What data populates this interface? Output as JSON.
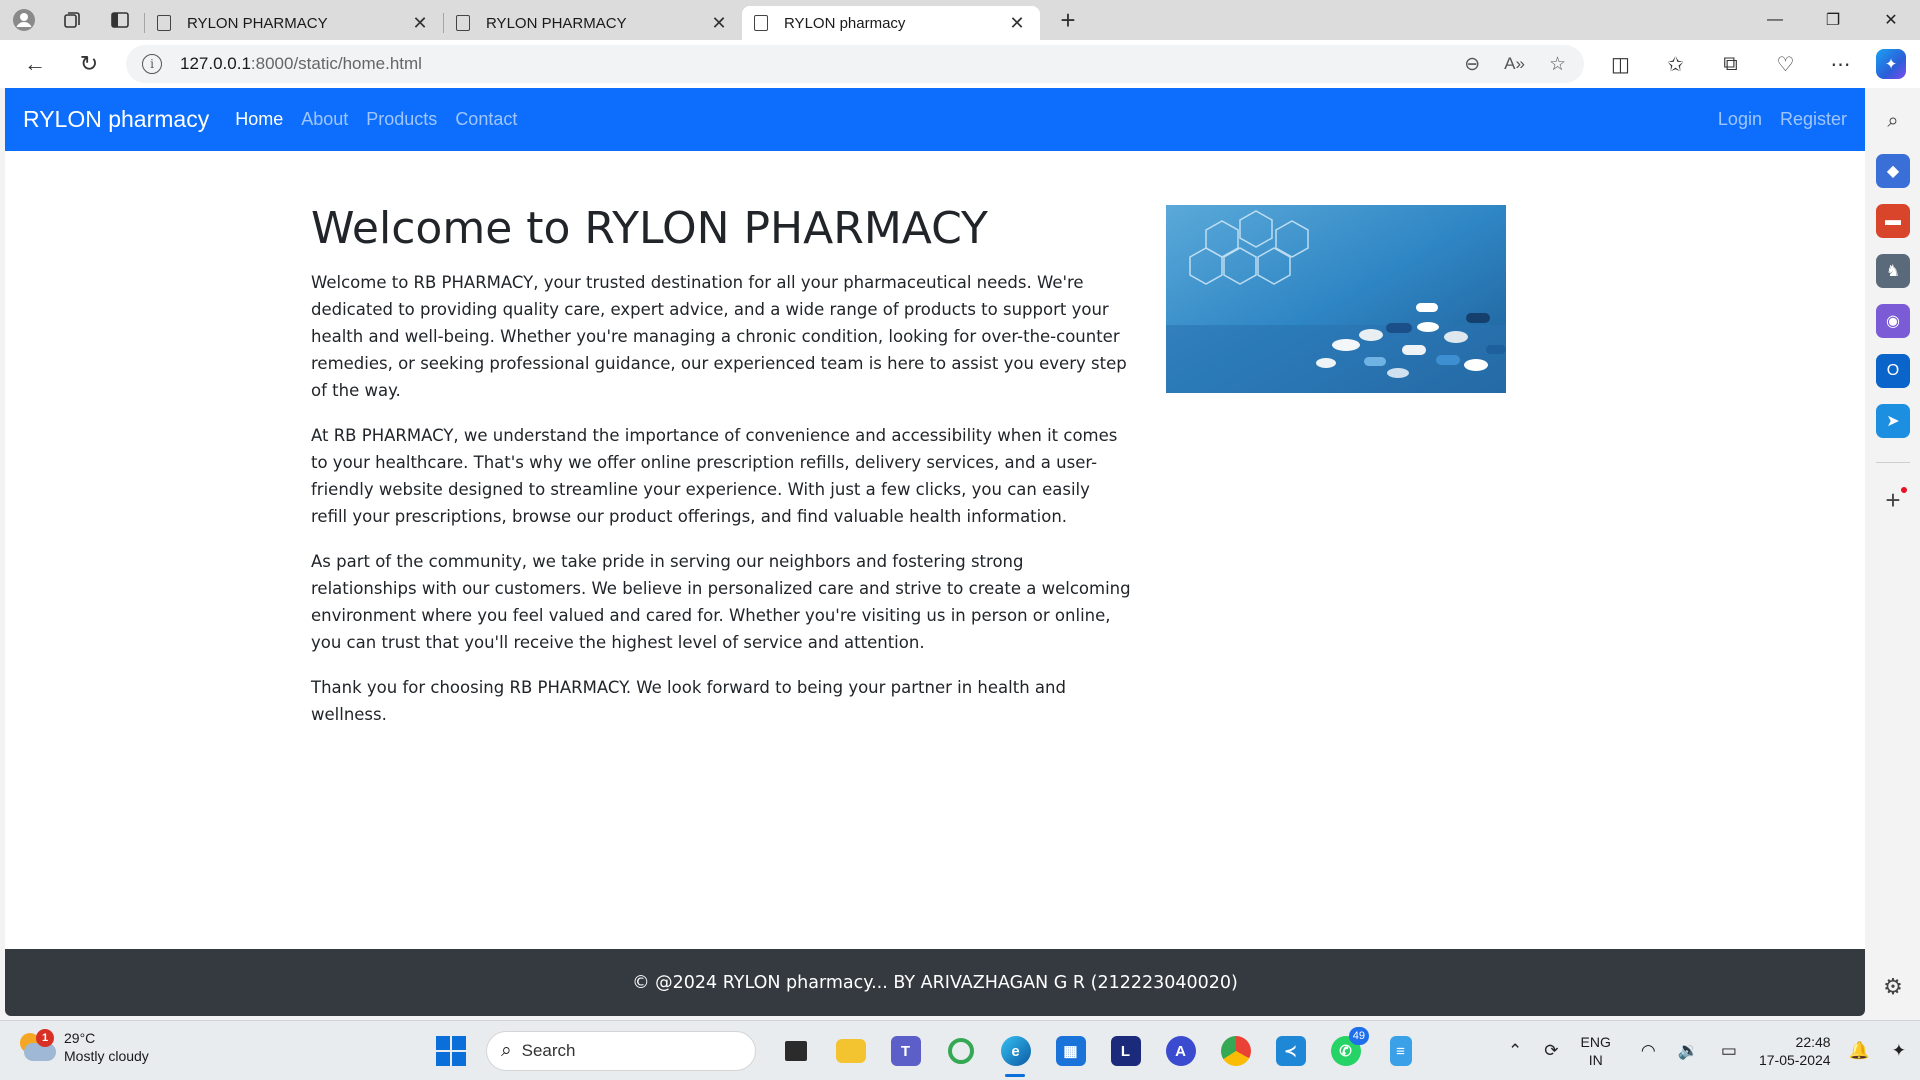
{
  "browser": {
    "tabs": [
      {
        "title": "RYLON PHARMACY",
        "active": false
      },
      {
        "title": "RYLON PHARMACY",
        "active": false
      },
      {
        "title": "RYLON pharmacy",
        "active": true
      }
    ],
    "url_host": "127.0.0.1",
    "url_rest": ":8000/static/home.html"
  },
  "site": {
    "brand": "RYLON pharmacy",
    "nav": {
      "home": "Home",
      "about": "About",
      "products": "Products",
      "contact": "Contact",
      "login": "Login",
      "register": "Register"
    },
    "heading": "Welcome to RYLON PHARMACY",
    "paragraphs": [
      "Welcome to RB PHARMACY, your trusted destination for all your pharmaceutical needs. We're dedicated to providing quality care, expert advice, and a wide range of products to support your health and well-being. Whether you're managing a chronic condition, looking for over-the-counter remedies, or seeking professional guidance, our experienced team is here to assist you every step of the way.",
      "At RB PHARMACY, we understand the importance of convenience and accessibility when it comes to your healthcare. That's why we offer online prescription refills, delivery services, and a user-friendly website designed to streamline your experience. With just a few clicks, you can easily refill your prescriptions, browse our product offerings, and find valuable health information.",
      "As part of the community, we take pride in serving our neighbors and fostering strong relationships with our customers. We believe in personalized care and strive to create a welcoming environment where you feel valued and cared for. Whether you're visiting us in person or online, you can trust that you'll receive the highest level of service and attention.",
      "Thank you for choosing RB PHARMACY. We look forward to being your partner in health and wellness."
    ],
    "footer": "© @2024 RYLON pharmacy... BY ARIVAZHAGAN G R (212223040020)"
  },
  "taskbar": {
    "weather_temp": "29°C",
    "weather_desc": "Mostly cloudy",
    "weather_badge": "1",
    "search_placeholder": "Search",
    "whatsapp_badge": "49",
    "lang_1": "ENG",
    "lang_2": "IN",
    "time": "22:48",
    "date": "17-05-2024"
  },
  "colors": {
    "navbar": "#0d6efd",
    "footer": "#343a40"
  }
}
